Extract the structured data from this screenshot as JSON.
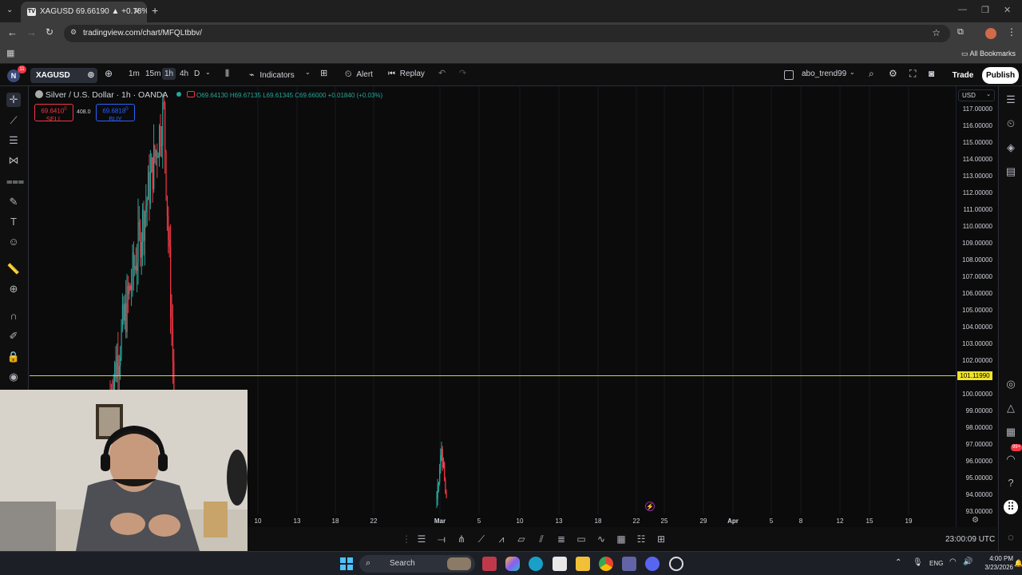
{
  "browser": {
    "tab_title": "XAGUSD 69.66190 ▲ +0.78% at",
    "url": "tradingview.com/chart/MFQLtbbv/",
    "bookmarks_label": "All Bookmarks"
  },
  "toolbar": {
    "notification_count": "11",
    "avatar_letter": "N",
    "symbol": "XAGUSD",
    "intervals": [
      "1m",
      "15m",
      "1h",
      "4h",
      "D"
    ],
    "active_interval": "1h",
    "indicators_label": "Indicators",
    "alert_label": "Alert",
    "replay_label": "Replay",
    "layout_name": "abo_trend99",
    "trade_label": "Trade",
    "publish_label": "Publish"
  },
  "legend": {
    "title": "Silver / U.S. Dollar · 1h · OANDA",
    "o": "O69.64130",
    "h": "H69.67135",
    "l": "L69.61345",
    "c": "C69.66000",
    "chg": "+0.01840 (+0.03%)",
    "sell_price": "69.6410",
    "sell_sup": "0",
    "sell_label": "SELL",
    "spread": "408.0",
    "buy_price": "69.6818",
    "buy_sup": "0",
    "buy_label": "BUY"
  },
  "currency": "USD",
  "horizontal_line_label": "101.11990",
  "price_ticks": [
    "117.00000",
    "116.00000",
    "115.00000",
    "114.00000",
    "113.00000",
    "112.00000",
    "111.00000",
    "110.00000",
    "109.00000",
    "108.00000",
    "107.00000",
    "106.00000",
    "105.00000",
    "104.00000",
    "103.00000",
    "102.00000",
    "100.00000",
    "99.00000",
    "98.00000",
    "97.00000",
    "96.00000",
    "95.00000",
    "94.00000",
    "93.00000"
  ],
  "time_ticks": [
    "10",
    "13",
    "18",
    "22",
    "Mar",
    "5",
    "10",
    "13",
    "18",
    "22",
    "25",
    "29",
    "Apr",
    "5",
    "8",
    "12",
    "15",
    "19"
  ],
  "time_utc": "23:00:09 UTC",
  "badge_right": "99+",
  "taskbar": {
    "search_placeholder": "Search",
    "lang": "ENG",
    "time": "4:00 PM",
    "date": "3/23/2026"
  },
  "colors": {
    "up": "#26a69a",
    "down": "#f23645",
    "hline": "#f0e42a",
    "bg": "#0b0b0b"
  }
}
